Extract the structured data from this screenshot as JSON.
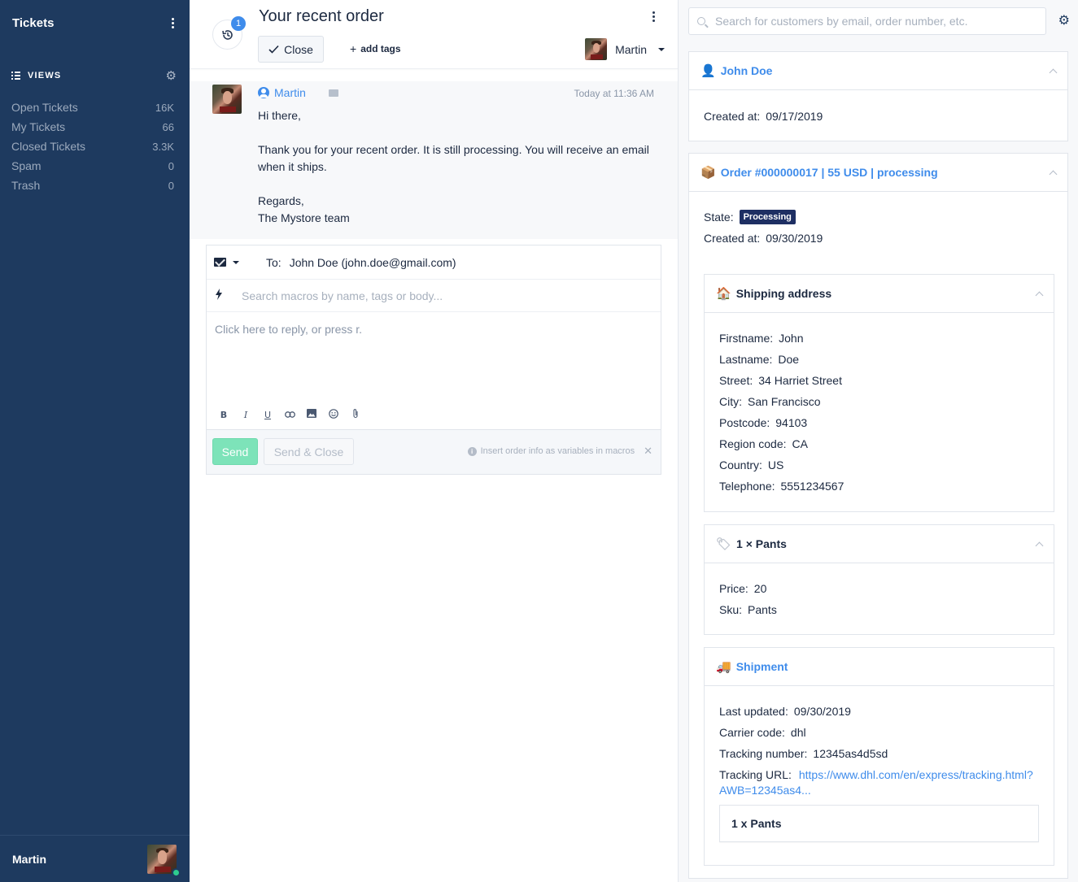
{
  "sidebar": {
    "title": "Tickets",
    "views_label": "VIEWS",
    "views": [
      {
        "label": "Open Tickets",
        "count": "16K"
      },
      {
        "label": "My Tickets",
        "count": "66"
      },
      {
        "label": "Closed Tickets",
        "count": "3.3K"
      },
      {
        "label": "Spam",
        "count": "0"
      },
      {
        "label": "Trash",
        "count": "0"
      }
    ],
    "user_name": "Martin"
  },
  "ticket": {
    "title": "Your recent order",
    "history_count": "1",
    "close_label": "Close",
    "add_tags_label": "add tags",
    "assignee": "Martin"
  },
  "message": {
    "author": "Martin",
    "time": "Today at 11:36 AM",
    "lines": [
      "Hi there,",
      "",
      "Thank you for your recent order. It is still processing. You will receive an email when it ships.",
      "",
      "Regards,",
      "The Mystore team"
    ]
  },
  "reply": {
    "to_label": "To:",
    "to_value": "John Doe (john.doe@gmail.com)",
    "macro_placeholder": "Search macros by name, tags or body...",
    "reply_placeholder": "Click here to reply, or press r.",
    "send_label": "Send",
    "send_close_label": "Send & Close",
    "hint": "Insert order info as variables in macros",
    "toolbar": [
      "B",
      "I",
      "U",
      "🔗",
      "▣",
      "☺",
      "📎"
    ]
  },
  "customer_panel": {
    "search_placeholder": "Search for customers by email, order number, etc.",
    "customer": {
      "name": "John Doe",
      "created_label": "Created at:",
      "created_value": "09/17/2019"
    },
    "order": {
      "title": "Order #000000017 | 55 USD | processing",
      "state_label": "State:",
      "state_value": "Processing",
      "created_label": "Created at:",
      "created_value": "09/30/2019"
    },
    "shipping": {
      "title": "Shipping address",
      "fields": [
        {
          "k": "Firstname:",
          "v": "John"
        },
        {
          "k": "Lastname:",
          "v": "Doe"
        },
        {
          "k": "Street:",
          "v": "34 Harriet Street"
        },
        {
          "k": "City:",
          "v": "San Francisco"
        },
        {
          "k": "Postcode:",
          "v": "94103"
        },
        {
          "k": "Region code:",
          "v": "CA"
        },
        {
          "k": "Country:",
          "v": "US"
        },
        {
          "k": "Telephone:",
          "v": "5551234567"
        }
      ]
    },
    "line_item": {
      "title": "1 × Pants",
      "fields": [
        {
          "k": "Price:",
          "v": "20"
        },
        {
          "k": "Sku:",
          "v": "Pants"
        }
      ]
    },
    "shipment": {
      "title": "Shipment",
      "fields": [
        {
          "k": "Last updated:",
          "v": "09/30/2019"
        },
        {
          "k": "Carrier code:",
          "v": "dhl"
        },
        {
          "k": "Tracking number:",
          "v": "12345as4d5sd"
        }
      ],
      "url_label": "Tracking URL:",
      "url_line1": "https://www.dhl.com/en/express/tracking.html?",
      "url_line2": "AWB=12345as4...",
      "item": "1 x Pants"
    }
  },
  "colors": {
    "sidebar_bg": "#1e3a5f",
    "accent": "#3f8ceb",
    "send_green": "#7de3b9",
    "badge_navy": "#1e2f63"
  }
}
